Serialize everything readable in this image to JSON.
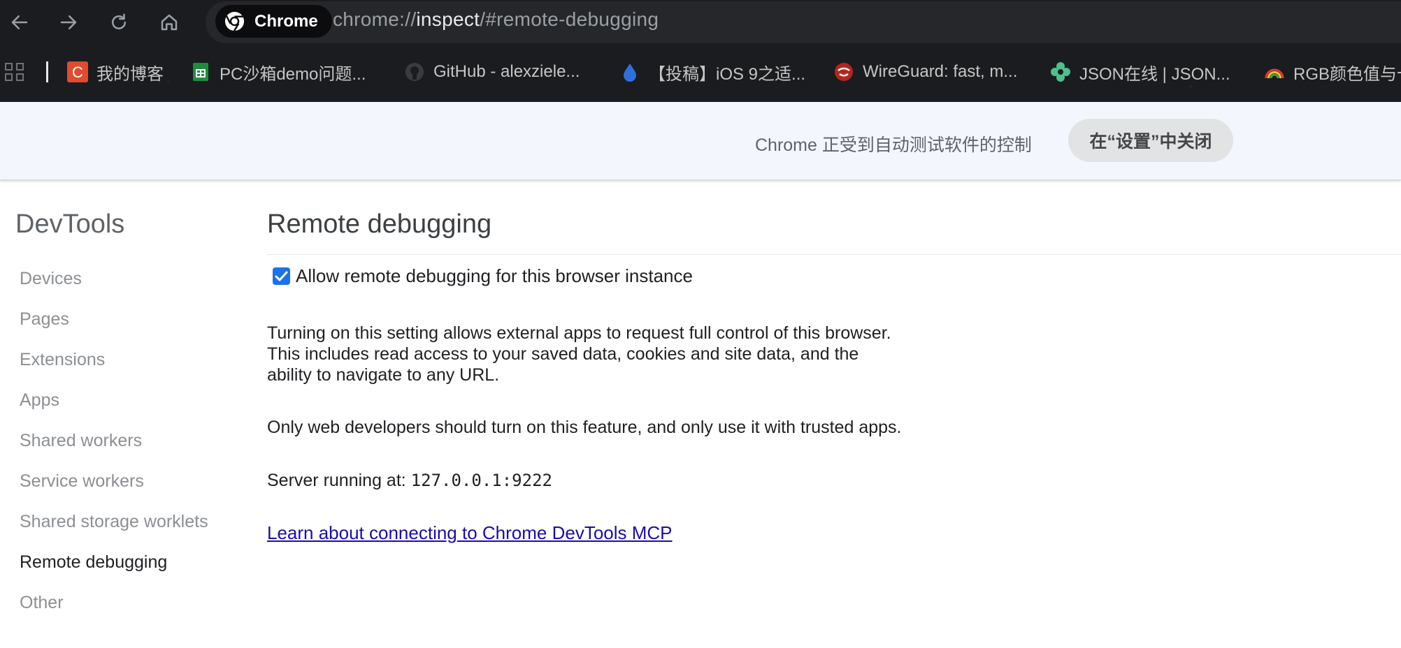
{
  "browser": {
    "chip_label": "Chrome",
    "url_scheme": "chrome://",
    "url_host": "inspect",
    "url_path": "/#remote-debugging"
  },
  "bookmarks": [
    {
      "label": "我的博客",
      "icon": "csdn-icon",
      "color": "#e24b2f"
    },
    {
      "label": "PC沙箱demo问题...",
      "icon": "sheets-icon",
      "color": "#1e8e3e"
    },
    {
      "label": "GitHub - alexziele...",
      "icon": "github-icon",
      "color": "#3a3b3d"
    },
    {
      "label": "【投稿】iOS 9之适...",
      "icon": "drop-icon",
      "color": "#2f6fdc"
    },
    {
      "label": "WireGuard: fast, m...",
      "icon": "wireguard-icon",
      "color": "#b3261e"
    },
    {
      "label": "JSON在线 | JSON...",
      "icon": "flower-icon",
      "color": "#4fc08d"
    },
    {
      "label": "RGB颜色值与十",
      "icon": "rainbow-icon",
      "color": "#e53935"
    }
  ],
  "infobar": {
    "message": "Chrome 正受到自动测试软件的控制",
    "button": "在“设置”中关闭"
  },
  "sidebar": {
    "title": "DevTools",
    "items": [
      {
        "label": "Devices"
      },
      {
        "label": "Pages"
      },
      {
        "label": "Extensions"
      },
      {
        "label": "Apps"
      },
      {
        "label": "Shared workers"
      },
      {
        "label": "Service workers"
      },
      {
        "label": "Shared storage worklets"
      },
      {
        "label": "Remote debugging"
      },
      {
        "label": "Other"
      }
    ],
    "selected": "Remote debugging"
  },
  "main": {
    "title": "Remote debugging",
    "checkbox_label": "Allow remote debugging for this browser instance",
    "checkbox_checked": true,
    "warning_lines": [
      "Turning on this setting allows external apps to request full control of this browser.",
      "This includes read access to your saved data, cookies and site data, and the",
      "ability to navigate to any URL."
    ],
    "dev_note": "Only web developers should turn on this feature, and only use it with trusted apps.",
    "server_label": "Server running at:",
    "server_address": "127.0.0.1:9222",
    "link_text": "Learn about connecting to Chrome DevTools MCP"
  },
  "colors": {
    "accent": "#1a73e8",
    "link": "#1a0dab",
    "infobar_bg": "#f3f6fc"
  }
}
